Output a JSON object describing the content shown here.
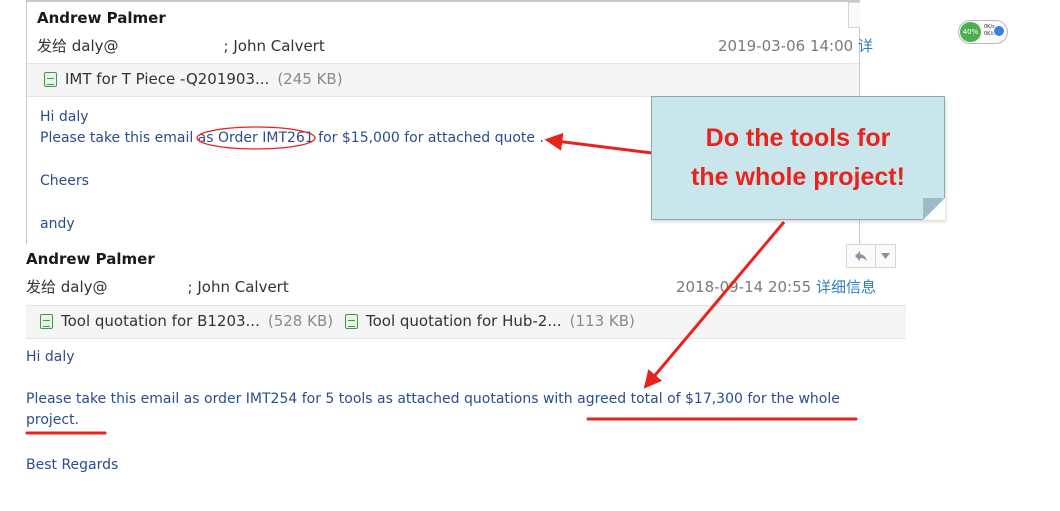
{
  "email_top": {
    "sender": "Andrew Palmer",
    "to_prefix": "发给 daly@",
    "to_suffix": "; John Calvert",
    "date": "2019-03-06 14:00",
    "details_truncated": "详",
    "attachment": {
      "name": "IMT for T Piece -Q201903...",
      "size": "(245 KB)"
    },
    "body": {
      "greeting": "Hi daly",
      "line_before": "Please take this email as ",
      "order_highlight": "Order IMT261 for $15,000",
      "line_after": " for attached quote .",
      "signoff": "Cheers",
      "signature": "andy"
    }
  },
  "email_bottom": {
    "sender": "Andrew Palmer",
    "to_prefix": "发给 daly@",
    "to_suffix": "; John Calvert",
    "date": "2018-09-14 20:55",
    "details_label": "详细信息",
    "attachments": [
      {
        "name": "Tool quotation for B1203...",
        "size": "(528 KB)"
      },
      {
        "name": "Tool quotation for Hub-2...",
        "size": "(113 KB)"
      }
    ],
    "body": {
      "greeting": "Hi daly",
      "line1_before": "Please take this email as order IMT254  for 5 tools as attached quotations with ",
      "line1_highlight": "agreed total of $17,300 for the whole",
      "line2": "project.",
      "signoff": "Best Regards"
    }
  },
  "callout": {
    "line1": "Do the tools for",
    "line2": "the whole project!"
  },
  "net_widget": {
    "percent": "40%",
    "up": "0K/s",
    "down": "0K/s"
  },
  "colors": {
    "annotation_red": "#e8231c",
    "callout_fill": "#c9e6ec",
    "body_text": "#2b4d8c",
    "link": "#2a7fc3"
  }
}
